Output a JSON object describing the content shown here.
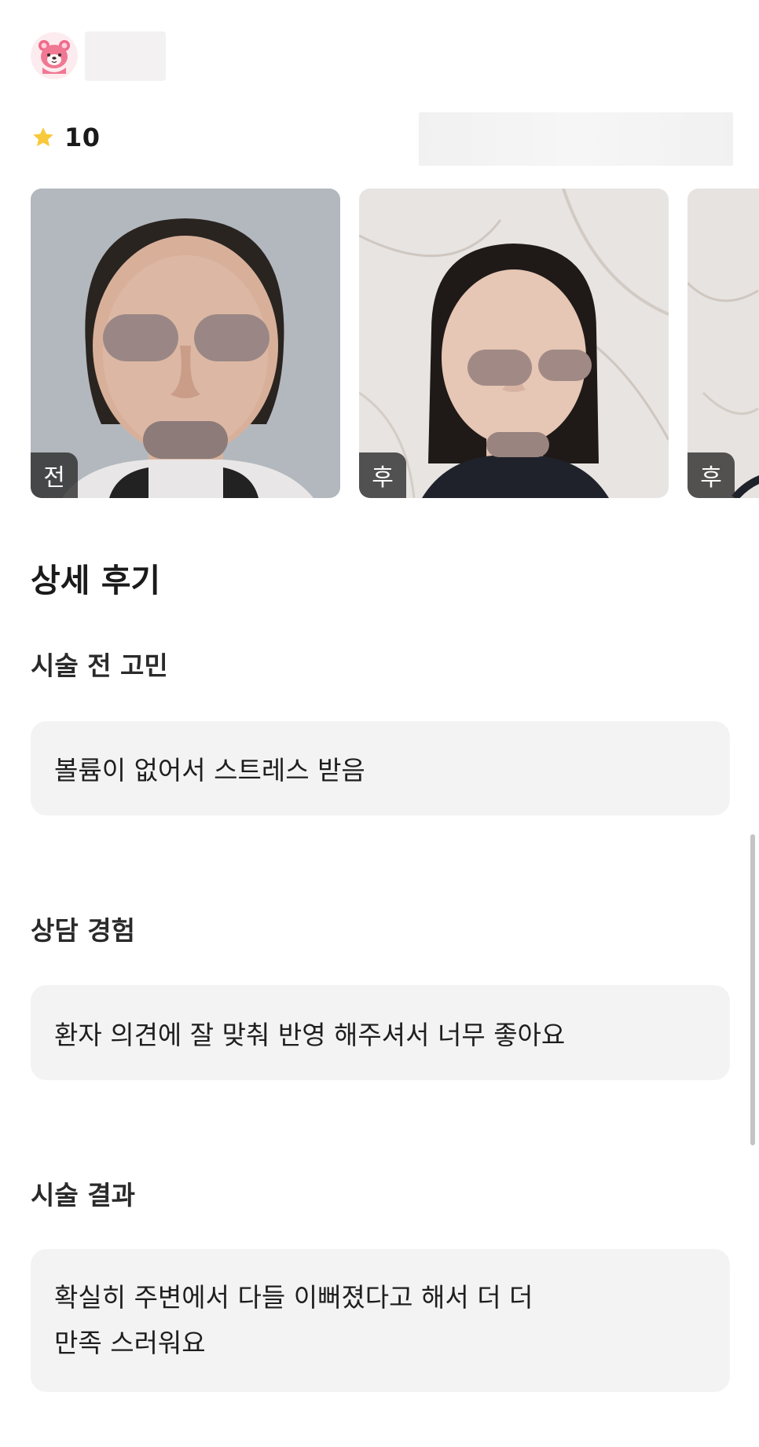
{
  "review": {
    "rating": "10",
    "photos": [
      {
        "tag": "전"
      },
      {
        "tag": "후"
      },
      {
        "tag": "후"
      }
    ],
    "section_title": "상세 후기",
    "questions": [
      {
        "label": "시술 전 고민",
        "answer": "볼륨이 없어서 스트레스 받음"
      },
      {
        "label": "상담 경험",
        "answer": "환자 의견에 잘 맞춰 반영 해주셔서 너무 좋아요"
      },
      {
        "label": "시술 결과",
        "answer_line1": "확실히 주변에서 다들 이뻐졌다고 해서 더 더",
        "answer_line2": "만족 스러워요"
      }
    ]
  },
  "colors": {
    "star": "#f8c93c",
    "answer_bg": "#f3f3f3",
    "tag_bg": "#2f2f2f"
  },
  "icons": {
    "avatar": "pink-bear-icon",
    "rating": "star-icon"
  }
}
